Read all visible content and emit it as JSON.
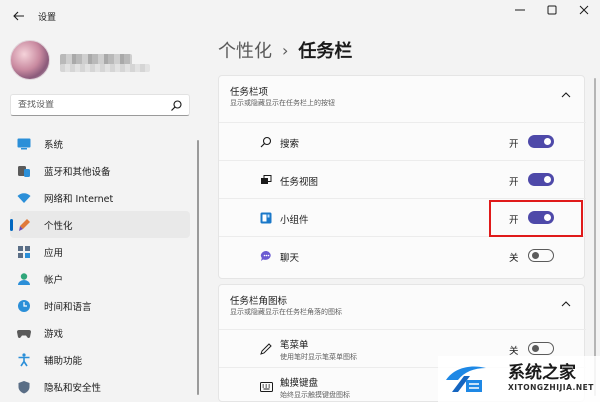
{
  "window": {
    "title": "设置",
    "back_icon": "back-arrow-icon",
    "controls": [
      "minimize-icon",
      "maximize-icon",
      "close-icon"
    ]
  },
  "profile": {
    "avatar": "avatar"
  },
  "search": {
    "placeholder": "查找设置",
    "icon": "search-icon"
  },
  "sidebar": {
    "items": [
      {
        "label": "系统",
        "icon": "system-display-icon",
        "active": false
      },
      {
        "label": "蓝牙和其他设备",
        "icon": "bluetooth-devices-icon",
        "active": false
      },
      {
        "label": "网络和 Internet",
        "icon": "wifi-icon",
        "active": false
      },
      {
        "label": "个性化",
        "icon": "personalization-brush-icon",
        "active": true
      },
      {
        "label": "应用",
        "icon": "apps-icon",
        "active": false
      },
      {
        "label": "帐户",
        "icon": "account-icon",
        "active": false
      },
      {
        "label": "时间和语言",
        "icon": "time-language-icon",
        "active": false
      },
      {
        "label": "游戏",
        "icon": "gaming-icon",
        "active": false
      },
      {
        "label": "辅助功能",
        "icon": "accessibility-icon",
        "active": false
      },
      {
        "label": "隐私和安全性",
        "icon": "privacy-shield-icon",
        "active": false
      }
    ]
  },
  "breadcrumb": {
    "parent": "个性化",
    "separator": "›",
    "current": "任务栏"
  },
  "taskbar_items": {
    "title": "任务栏项",
    "subtitle": "显示或隐藏显示在任务栏上的按钮",
    "rows": [
      {
        "label": "搜索",
        "icon": "search-icon",
        "state": "开",
        "on": true
      },
      {
        "label": "任务视图",
        "icon": "task-view-icon",
        "state": "开",
        "on": true
      },
      {
        "label": "小组件",
        "icon": "widgets-icon",
        "state": "开",
        "on": true
      },
      {
        "label": "聊天",
        "icon": "chat-icon",
        "state": "关",
        "on": false
      }
    ]
  },
  "corner_icons": {
    "title": "任务栏角图标",
    "subtitle": "显示或隐藏显示在任务栏角落的图标",
    "rows": [
      {
        "label": "笔菜单",
        "sub": "使用笔时显示笔菜单图标",
        "icon": "pen-icon",
        "state": "关",
        "on": false
      },
      {
        "label": "触摸键盘",
        "sub": "始终显示触摸键盘图标",
        "icon": "keyboard-icon",
        "state": "",
        "on": false
      }
    ]
  },
  "watermark": {
    "text": "系统之家",
    "url": "XITONGZHIJIA.NET"
  },
  "colors": {
    "accent": "#4e49a9",
    "nav_indicator": "#0067c0",
    "highlight": "#e01a1a"
  }
}
